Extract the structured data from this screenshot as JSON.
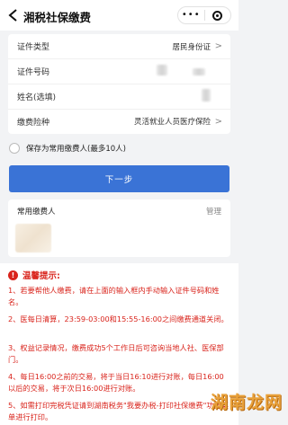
{
  "header": {
    "title": "湘税社保缴费",
    "more": "•••"
  },
  "form": {
    "fields": [
      {
        "label": "证件类型",
        "value": "居民身份证"
      },
      {
        "label": "证件号码",
        "value": ""
      },
      {
        "label": "姓名(选填)",
        "value": ""
      },
      {
        "label": "缴费险种",
        "value": "灵活就业人员医疗保险"
      }
    ]
  },
  "save_option": {
    "label": "保存为常用缴费人(最多10人)"
  },
  "next_button": {
    "label": "下一步"
  },
  "payers": {
    "heading": "常用缴费人",
    "manage": "管理"
  },
  "tips": {
    "title": "温馨提示:",
    "items": [
      "1、若要帮他人缴费，请在上面的输入框内手动输入证件号码和姓名。",
      "2、医每日清算，23:59-03:00和15:55-16:00之间缴费通道关闭。",
      "3、权益记录情况，缴费成功5个工作日后可咨询当地人社、医保部门。",
      "4、每日16:00之前的交易，将于当日16:10进行对账，每日16:00以后的交易，将于次日16:00进行对账。",
      "5、如需打印完税凭证请到湖南税务\"我要办税-打印社保缴费\"功能菜单进行打印。"
    ]
  },
  "watermark": {
    "text": "湖南龙网"
  },
  "colors": {
    "primary": "#3a73d6",
    "warning": "#d9241c"
  }
}
